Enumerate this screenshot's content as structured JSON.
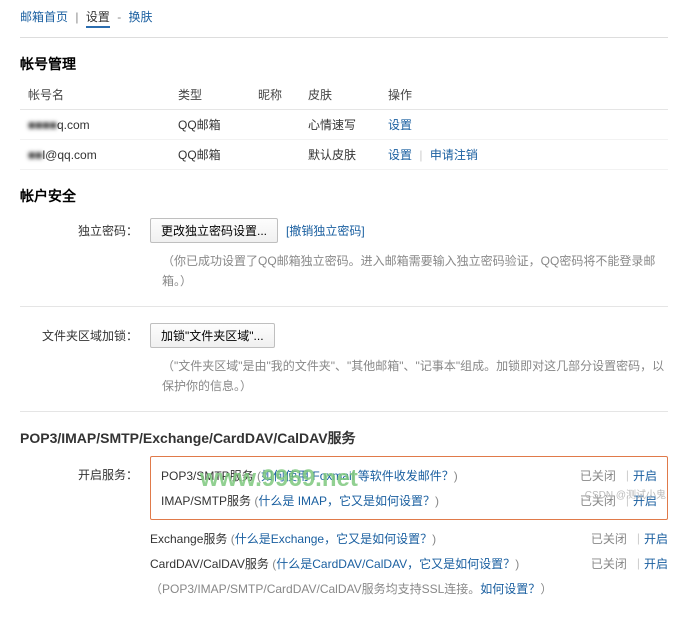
{
  "nav": {
    "home": "邮箱首页",
    "settings": "设置",
    "skin": "换肤",
    "sep": "|",
    "dash": "-"
  },
  "accounts": {
    "title": "帐号管理",
    "headers": {
      "name": "帐号名",
      "type": "类型",
      "nick": "昵称",
      "skin": "皮肤",
      "op": "操作"
    },
    "rows": [
      {
        "name_blur": "■■■■",
        "name_suffix": "q.com",
        "type": "QQ邮箱",
        "nick": "",
        "skin": "心情速写",
        "ops": [
          "设置"
        ]
      },
      {
        "name_blur": "■■",
        "name_suffix": "l@qq.com",
        "type": "QQ邮箱",
        "nick": "",
        "skin": "默认皮肤",
        "ops": [
          "设置",
          "申请注销"
        ]
      }
    ]
  },
  "security": {
    "title": "帐户安全",
    "pwd_label": "独立密码：",
    "pwd_btn": "更改独立密码设置...",
    "pwd_revoke": "[撤销独立密码]",
    "pwd_hint": "（你已成功设置了QQ邮箱独立密码。进入邮箱需要输入独立密码验证，QQ密码将不能登录邮箱。）",
    "lock_label": "文件夹区域加锁：",
    "lock_btn": "加锁\"文件夹区域\"...",
    "lock_hint": "（\"文件夹区域\"是由\"我的文件夹\"、\"其他邮箱\"、\"记事本\"组成。加锁即对这几部分设置密码，以保护你的信息。）"
  },
  "services": {
    "title": "POP3/IMAP/SMTP/Exchange/CardDAV/CalDAV服务",
    "enable_label": "开启服务：",
    "closed": "已关闭",
    "open": "开启",
    "sep": "|",
    "rows": [
      {
        "name": "POP3/SMTP服务",
        "help": "如何使用 Foxmail 等软件收发邮件？",
        "box": true
      },
      {
        "name": "IMAP/SMTP服务",
        "help": "什么是 IMAP，它又是如何设置？",
        "box": true
      },
      {
        "name": "Exchange服务",
        "help": "什么是Exchange，它又是如何设置？",
        "box": false
      },
      {
        "name": "CardDAV/CalDAV服务",
        "help": "什么是CardDAV/CalDAV，它又是如何设置？",
        "box": false
      }
    ],
    "foot_pre": "（POP3/IMAP/SMTP/CardDAV/CalDAV服务均支持SSL连接。",
    "foot_link": "如何设置？",
    "foot_post": "）"
  },
  "watermark": "www.9969.net",
  "csdn": "CSDN @测试小鬼"
}
